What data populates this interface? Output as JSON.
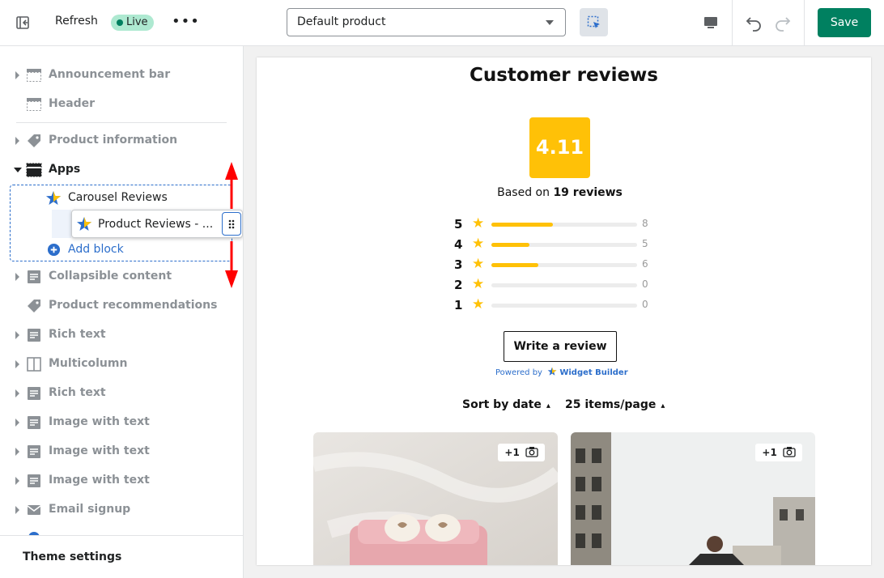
{
  "topbar": {
    "refresh_label": "Refresh",
    "live_label": "Live",
    "more_label": "•••",
    "product_select_value": "Default product",
    "save_label": "Save"
  },
  "sidebar": {
    "items": [
      {
        "label": "Announcement bar",
        "icon": "section-icon"
      },
      {
        "label": "Header",
        "icon": "section-icon"
      },
      {
        "label": "Product information",
        "icon": "tag-icon"
      },
      {
        "label": "Apps",
        "icon": "apps-icon"
      },
      {
        "label": "Collapsible content",
        "icon": "text-icon"
      },
      {
        "label": "Product recommendations",
        "icon": "tag-icon"
      },
      {
        "label": "Rich text",
        "icon": "text-icon"
      },
      {
        "label": "Multicolumn",
        "icon": "columns-icon"
      },
      {
        "label": "Rich text",
        "icon": "text-icon"
      },
      {
        "label": "Image with text",
        "icon": "text-icon"
      },
      {
        "label": "Image with text",
        "icon": "text-icon"
      },
      {
        "label": "Image with text",
        "icon": "text-icon"
      },
      {
        "label": "Email signup",
        "icon": "mail-icon"
      }
    ],
    "apps": {
      "carousel_label": "Carousel Reviews",
      "dragging_label": "Product Reviews - ...",
      "add_block_label": "Add block"
    },
    "theme_settings_label": "Theme settings"
  },
  "preview": {
    "title": "Customer reviews",
    "score": "4.11",
    "based_on_prefix": "Based on",
    "based_on_count": "19 reviews",
    "distribution": [
      {
        "stars": "5",
        "count": "8",
        "fraction": 0.42
      },
      {
        "stars": "4",
        "count": "5",
        "fraction": 0.26
      },
      {
        "stars": "3",
        "count": "6",
        "fraction": 0.32
      },
      {
        "stars": "2",
        "count": "0",
        "fraction": 0
      },
      {
        "stars": "1",
        "count": "0",
        "fraction": 0
      }
    ],
    "write_review_label": "Write a review",
    "powered_by": "Powered by",
    "widget_builder": "Widget Builder",
    "sort_label": "Sort by date",
    "per_page_label": "25 items/page",
    "photos": [
      {
        "badge": "+1"
      },
      {
        "badge": "+1"
      }
    ]
  },
  "colors": {
    "accent_green": "#008060",
    "star_yellow": "#ffc107",
    "link_blue": "#2c6ecb",
    "drag_arrow_red": "#ff0000"
  }
}
